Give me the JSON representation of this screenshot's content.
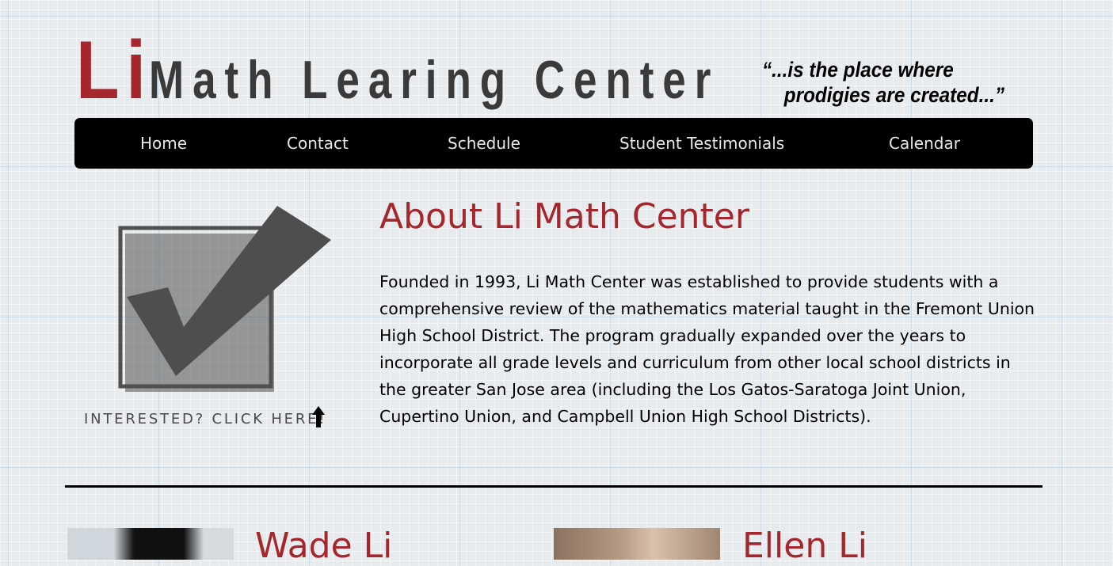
{
  "header": {
    "logo_li": "Li",
    "logo_rest": "Math Learing Center",
    "tagline_line1": "“...is the place where",
    "tagline_line2": "prodigies are created...”"
  },
  "nav": {
    "items": [
      {
        "label": "Home"
      },
      {
        "label": "Contact"
      },
      {
        "label": "Schedule"
      },
      {
        "label": "Student Testimonials"
      },
      {
        "label": "Calendar"
      }
    ]
  },
  "about": {
    "title": "About Li Math Center",
    "body": "Founded in 1993, Li Math Center was established to provide students with a comprehensive review of the mathematics material taught in the Fremont Union High School District. The program gradually expanded over the years to incorporate all grade levels and curriculum from other local school districts in the greater San Jose area (including the Los Gatos-Saratoga Joint Union, Cupertino Union, and Campbell Union High School Districts)."
  },
  "cta": {
    "label": "INTERESTED? CLICK HERE!",
    "icon": "checkmark-box-icon",
    "arrow_icon": "arrow-up-icon"
  },
  "people": [
    {
      "name": "Wade Li"
    },
    {
      "name": "Ellen Li"
    }
  ],
  "colors": {
    "accent": "#a6262d",
    "nav_bg": "#000000",
    "nav_text": "#e8e8e8",
    "logo_gray": "#3a3a3a"
  }
}
